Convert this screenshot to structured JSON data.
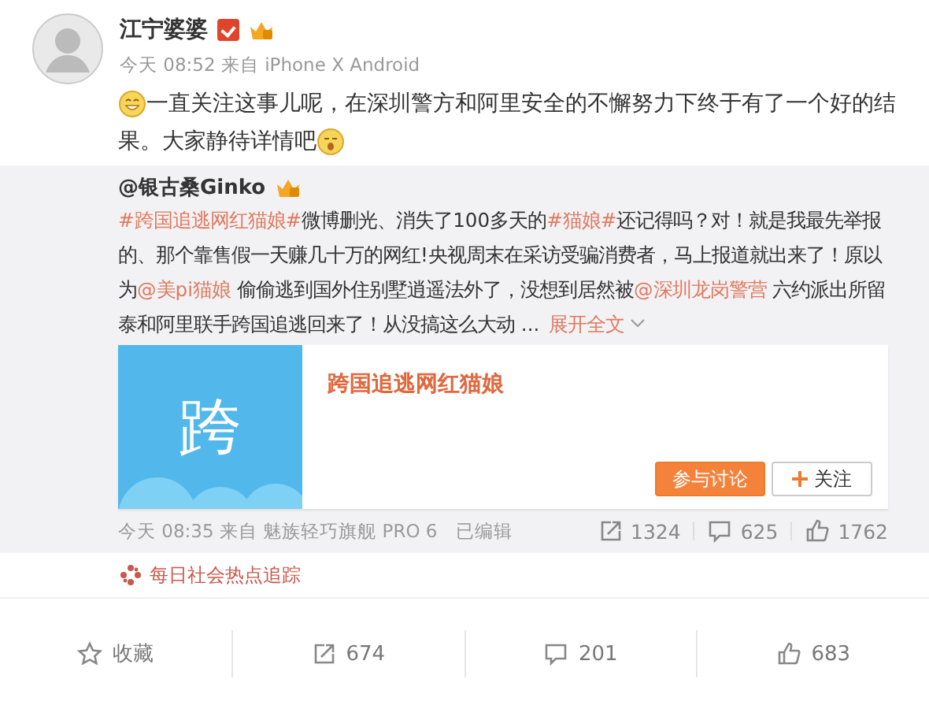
{
  "post": {
    "author": {
      "name": "江宁婆婆",
      "verified": true
    },
    "meta": "今天 08:52 来自 iPhone X Android",
    "lines": [
      "一直关注这事儿呢，在深圳警方和阿里安全的不懈努力下终于有了一个好的结",
      "果。大家静待详情吧"
    ]
  },
  "repost": {
    "author": "@银古桑Ginko",
    "segments": [
      {
        "kind": "link",
        "text": "#跨国追逃网红猫娘#"
      },
      {
        "kind": "text",
        "text": "微博删光、消失了100多天的"
      },
      {
        "kind": "link",
        "text": "#猫娘#"
      },
      {
        "kind": "text",
        "text": "还记得吗？对！就是我最先举报的、那个靠售假一天赚几十万的网红!央视周末在采访受骗消费者，马上报道就出来了！原以为"
      },
      {
        "kind": "link",
        "text": "@美pi猫娘"
      },
      {
        "kind": "text",
        "text": " 偷偷逃到国外住别墅逍遥法外了，没想到居然被"
      },
      {
        "kind": "link",
        "text": "@深圳龙岗警营"
      },
      {
        "kind": "text",
        "text": " 六约派出所留泰和阿里联手跨国追逃回来了！从没搞这么大动 ..."
      }
    ],
    "expand_link": "展开全文",
    "card": {
      "thumbnail_text": "跨",
      "title": "跨国追逃网红猫娘",
      "buttons": [
        {
          "kind": "primary",
          "label": "参与讨论"
        },
        {
          "kind": "follow",
          "label": "关注"
        }
      ]
    },
    "meta": "今天 08:35 来自 魅族轻巧旗舰 PRO 6",
    "edited": "已编辑",
    "stats": [
      {
        "kind": "repost",
        "count": "1324"
      },
      {
        "kind": "comment",
        "count": "625"
      },
      {
        "kind": "like",
        "count": "1762"
      }
    ]
  },
  "topic": "每日社会热点追踪",
  "actions": [
    {
      "kind": "favorite",
      "label": "收藏"
    },
    {
      "kind": "repost",
      "label": "674"
    },
    {
      "kind": "comment",
      "label": "201"
    },
    {
      "kind": "like",
      "label": "683"
    }
  ]
}
